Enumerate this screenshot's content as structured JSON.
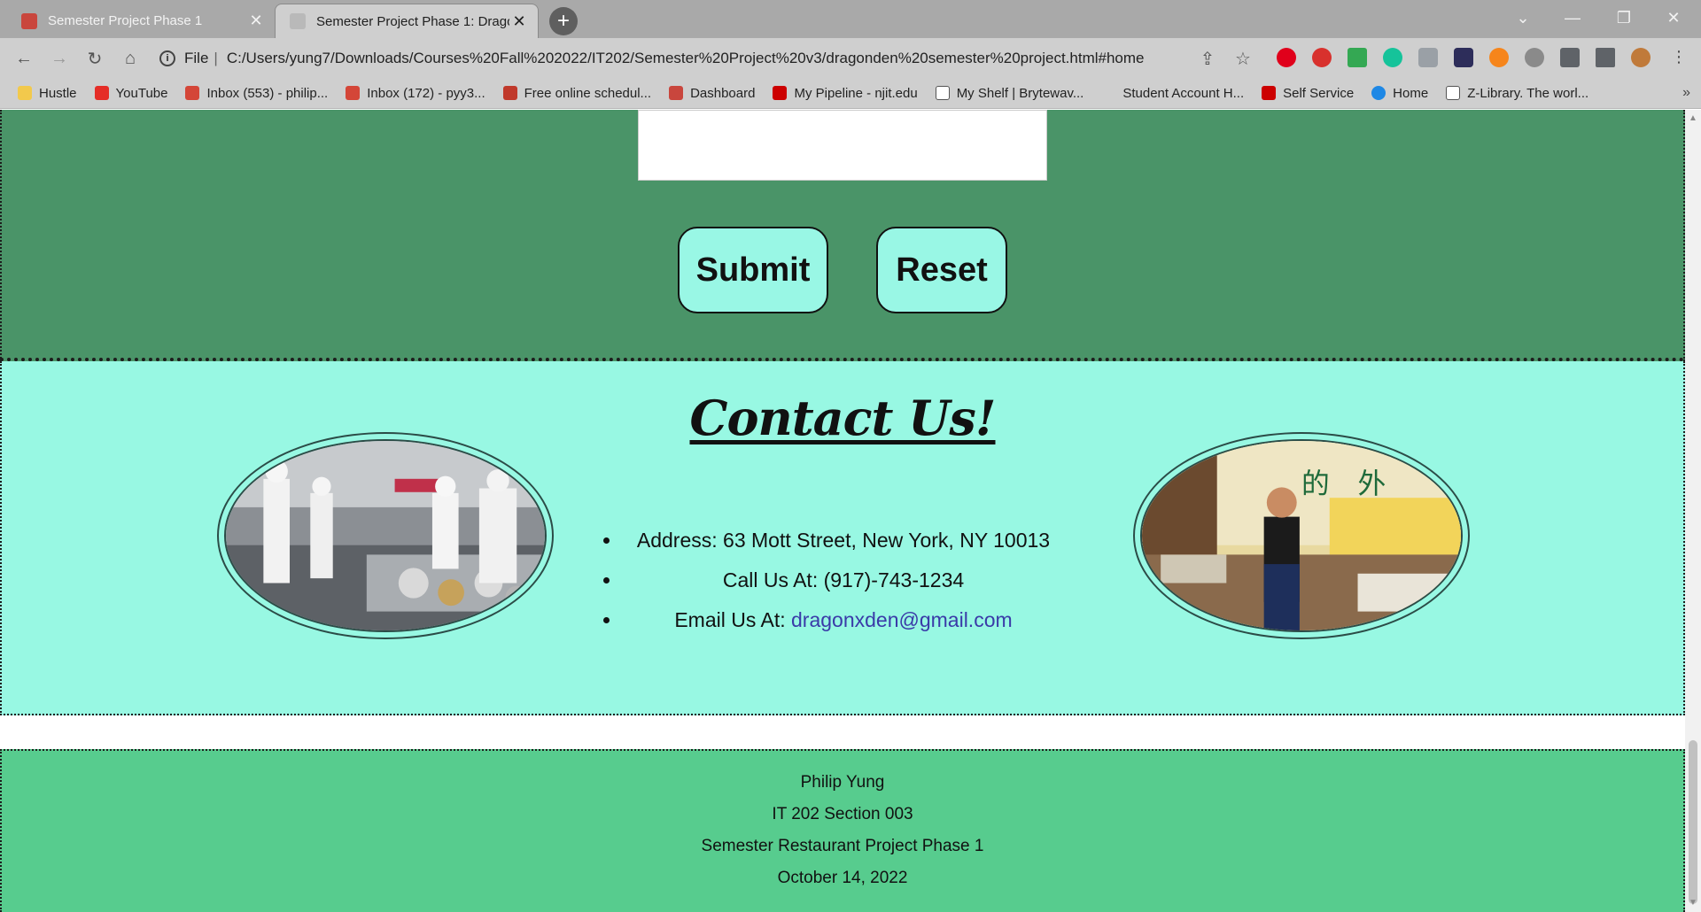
{
  "browser": {
    "tabs": [
      {
        "title": "Semester Project Phase 1",
        "active": false
      },
      {
        "title": "Semester Project Phase 1: Drago",
        "active": true
      }
    ],
    "new_tab_symbol": "+",
    "address": {
      "scheme_label": "File",
      "url": "C:/Users/yung7/Downloads/Courses%20Fall%202022/IT202/Semester%20Project%20v3/dragonden%20semester%20project.html#home"
    },
    "bookmarks": [
      {
        "label": "Hustle",
        "icon": "folder-icon",
        "color": "#f2c94c"
      },
      {
        "label": "YouTube",
        "icon": "youtube-icon",
        "color": "#e52d27"
      },
      {
        "label": "Inbox (553) - philip...",
        "icon": "gmail-icon",
        "color": "#d44638"
      },
      {
        "label": "Inbox (172) - pyy3...",
        "icon": "gmail-icon",
        "color": "#d44638"
      },
      {
        "label": "Free online schedul...",
        "icon": "calendar-icon",
        "color": "#c0392b"
      },
      {
        "label": "Dashboard",
        "icon": "canvas-icon",
        "color": "#c9463d"
      },
      {
        "label": "My Pipeline - njit.edu",
        "icon": "njit-icon",
        "color": "#cc0000"
      },
      {
        "label": "My Shelf | Brytewav...",
        "icon": "document-icon",
        "color": "#ffffff"
      },
      {
        "label": "Student Account H...",
        "icon": "blank-icon",
        "color": "#cfcfcf"
      },
      {
        "label": "Self Service",
        "icon": "njit-icon",
        "color": "#cc0000"
      },
      {
        "label": "Home",
        "icon": "cloud-icon",
        "color": "#1e88e5"
      },
      {
        "label": "Z-Library. The worl...",
        "icon": "zlibrary-icon",
        "color": "#ffffff"
      }
    ],
    "bookmarks_more": "»"
  },
  "form": {
    "submit_label": "Submit",
    "reset_label": "Reset"
  },
  "contact": {
    "title": "Contact Us!",
    "address": "Address: 63 Mott Street, New York, NY 10013",
    "phone": "Call Us At: (917)-743-1234",
    "email_prefix": "Email Us At: ",
    "email": "dragonxden@gmail.com"
  },
  "footer": {
    "name": "Philip Yung",
    "course": "IT 202 Section 003",
    "project": "Semester Restaurant Project Phase 1",
    "date": "October 14, 2022"
  },
  "colors": {
    "form_bg": "#4a9468",
    "contact_bg": "#98f8e3",
    "button_bg": "#99f7e5",
    "footer_bg": "#57cc8e",
    "link": "#3a3aa8"
  }
}
